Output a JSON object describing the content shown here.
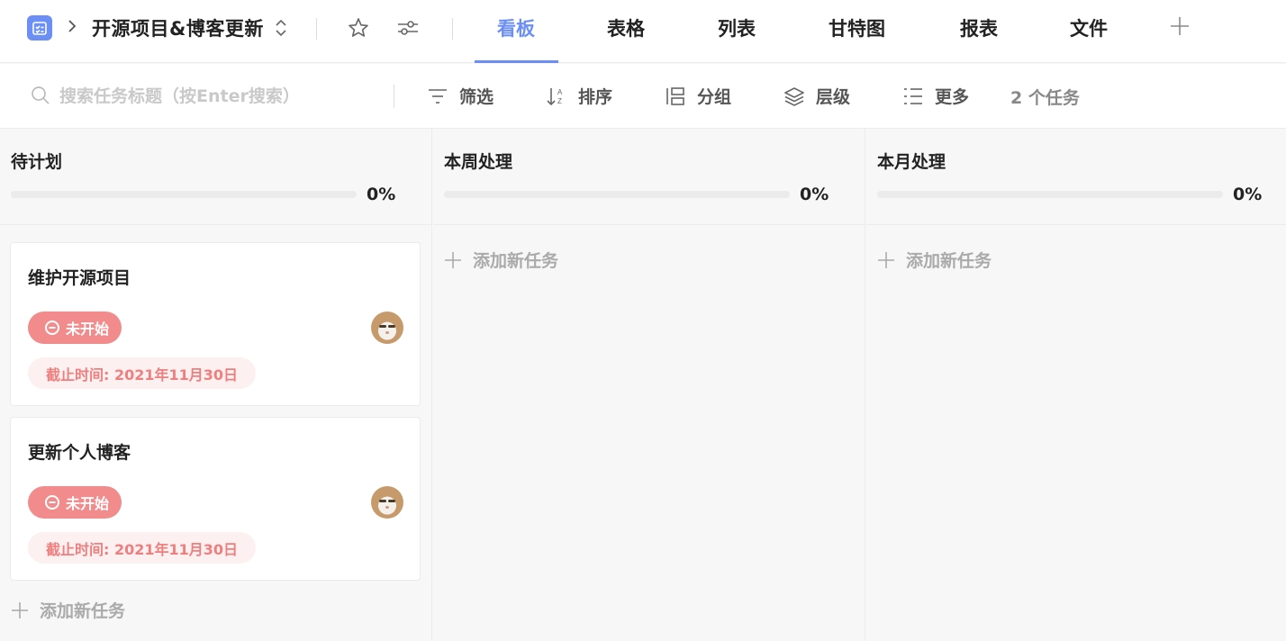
{
  "header": {
    "project_title": "开源项目&博客更新",
    "tabs": [
      {
        "label": "看板",
        "active": true
      },
      {
        "label": "表格"
      },
      {
        "label": "列表"
      },
      {
        "label": "甘特图"
      },
      {
        "label": "报表"
      },
      {
        "label": "文件"
      }
    ],
    "accent_color": "#6b8ff5"
  },
  "toolbar": {
    "search_placeholder": "搜索任务标题（按Enter搜索）",
    "filter_label": "筛选",
    "sort_label": "排序",
    "group_label": "分组",
    "level_label": "层级",
    "more_label": "更多",
    "task_count": "2 个任务"
  },
  "columns": [
    {
      "title": "待计划",
      "progress": "0%",
      "progress_value": 0,
      "cards": [
        {
          "title": "维护开源项目",
          "status": "未开始",
          "deadline": "截止时间: 2021年11月30日"
        },
        {
          "title": "更新个人博客",
          "status": "未开始",
          "deadline": "截止时间: 2021年11月30日"
        }
      ],
      "add_label": "添加新任务"
    },
    {
      "title": "本周处理",
      "progress": "0%",
      "progress_value": 0,
      "cards": [],
      "add_label": "添加新任务"
    },
    {
      "title": "本月处理",
      "progress": "0%",
      "progress_value": 0,
      "cards": [],
      "add_label": "添加新任务"
    }
  ],
  "colors": {
    "status_not_started": "#f28b8b",
    "deadline_bg": "#fdf0f0",
    "deadline_text": "#ef7f7f"
  }
}
